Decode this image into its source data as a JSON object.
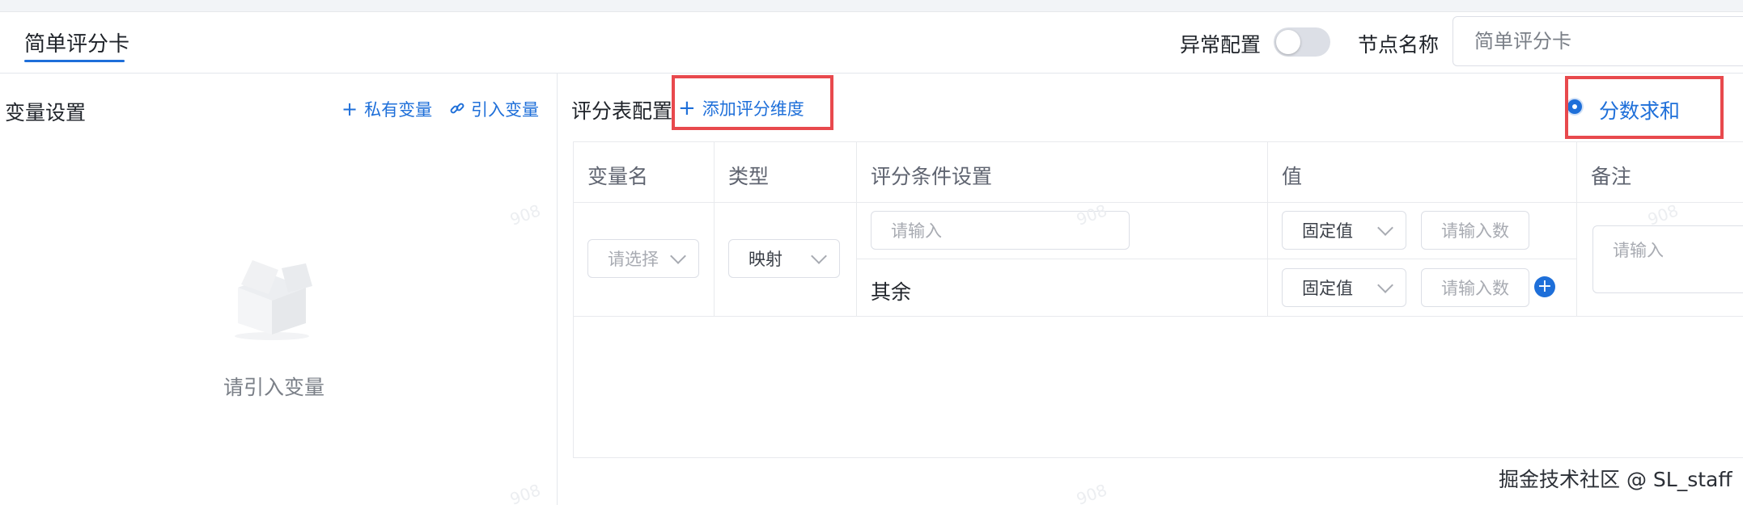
{
  "header": {
    "tab_label": "简单评分卡",
    "abnormal_config_label": "异常配置",
    "abnormal_config_on": false,
    "node_name_label": "节点名称",
    "node_name_value": "简单评分卡"
  },
  "variables": {
    "title": "变量设置",
    "private_var_label": "私有变量",
    "import_var_label": "引入变量",
    "empty_text": "请引入变量"
  },
  "scoring": {
    "title": "评分表配置",
    "add_dimension_label": "添加评分维度",
    "sum_label": "分数求和",
    "columns": [
      "变量名",
      "类型",
      "评分条件设置",
      "值",
      "备注"
    ],
    "row": {
      "var_select_placeholder": "请选择",
      "type_value": "映射",
      "condition_placeholder": "请输入",
      "other_label": "其余",
      "value_rows": [
        {
          "mode": "固定值",
          "placeholder": "请输入数"
        },
        {
          "mode": "固定值",
          "placeholder": "请输入数"
        }
      ],
      "remark_placeholder": "请输入"
    }
  },
  "watermark": "908",
  "credit": "掘金技术社区 @ SL_staff",
  "colors": {
    "accent": "#1e6fd9",
    "highlight": "#e8494d"
  }
}
